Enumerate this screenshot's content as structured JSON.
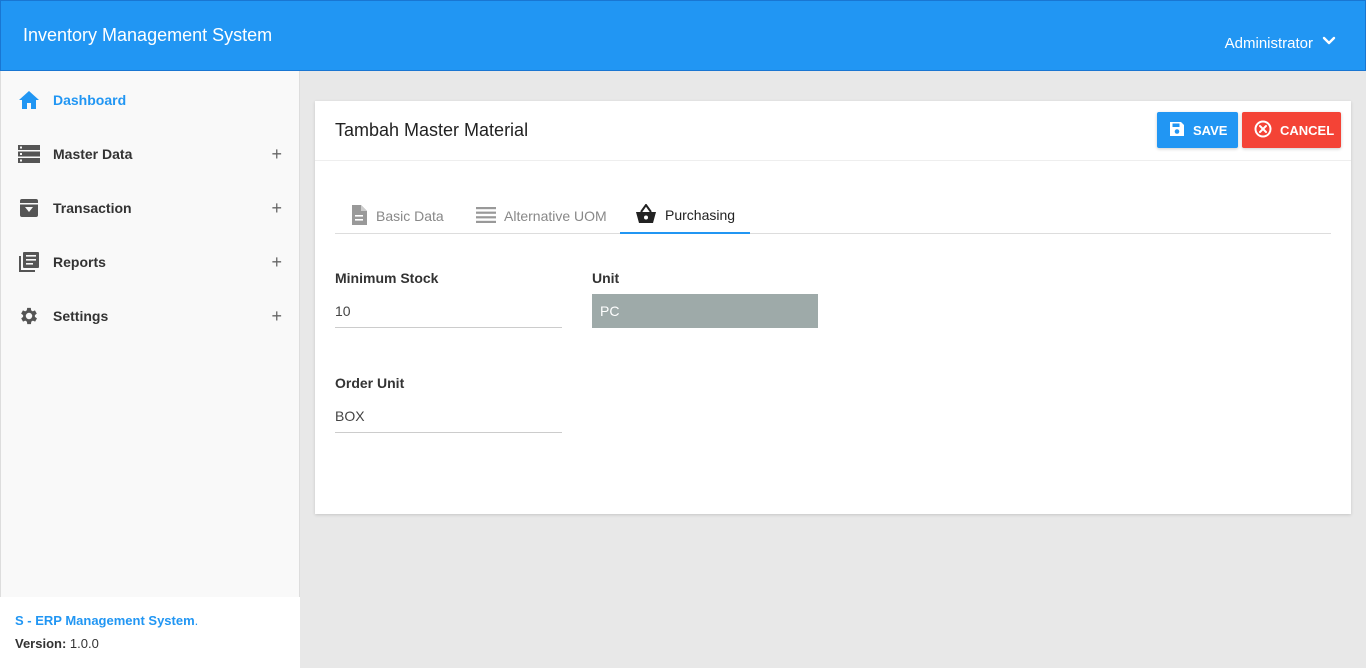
{
  "header": {
    "app_title": "Inventory Management System",
    "user_name": "Administrator",
    "brand_color": "#2196f3"
  },
  "sidebar": {
    "items": [
      {
        "label": "Dashboard",
        "icon": "home-icon",
        "active": true
      },
      {
        "label": "Master Data",
        "icon": "list-icon",
        "expand": "+"
      },
      {
        "label": "Transaction",
        "icon": "archive-icon",
        "expand": "+"
      },
      {
        "label": "Reports",
        "icon": "library-books-icon",
        "expand": "+"
      },
      {
        "label": "Settings",
        "icon": "gear-icon",
        "expand": "+"
      }
    ],
    "footer": {
      "brand": "S - ERP Management System",
      "brand_suffix": ".",
      "version_label": "Version:",
      "version_value": "1.0.0"
    }
  },
  "card": {
    "title": "Tambah Master Material",
    "save_label": "SAVE",
    "cancel_label": "CANCEL",
    "save_color": "#2196f3",
    "cancel_color": "#f44336"
  },
  "tabs": [
    {
      "label": "Basic Data",
      "icon": "document-icon",
      "active": false
    },
    {
      "label": "Alternative UOM",
      "icon": "lines-icon",
      "active": false
    },
    {
      "label": "Purchasing",
      "icon": "basket-icon",
      "active": true
    }
  ],
  "form": {
    "minimum_stock": {
      "label": "Minimum Stock",
      "value": "10"
    },
    "unit": {
      "label": "Unit",
      "value": "PC"
    },
    "order_unit": {
      "label": "Order Unit",
      "value": "BOX"
    }
  }
}
